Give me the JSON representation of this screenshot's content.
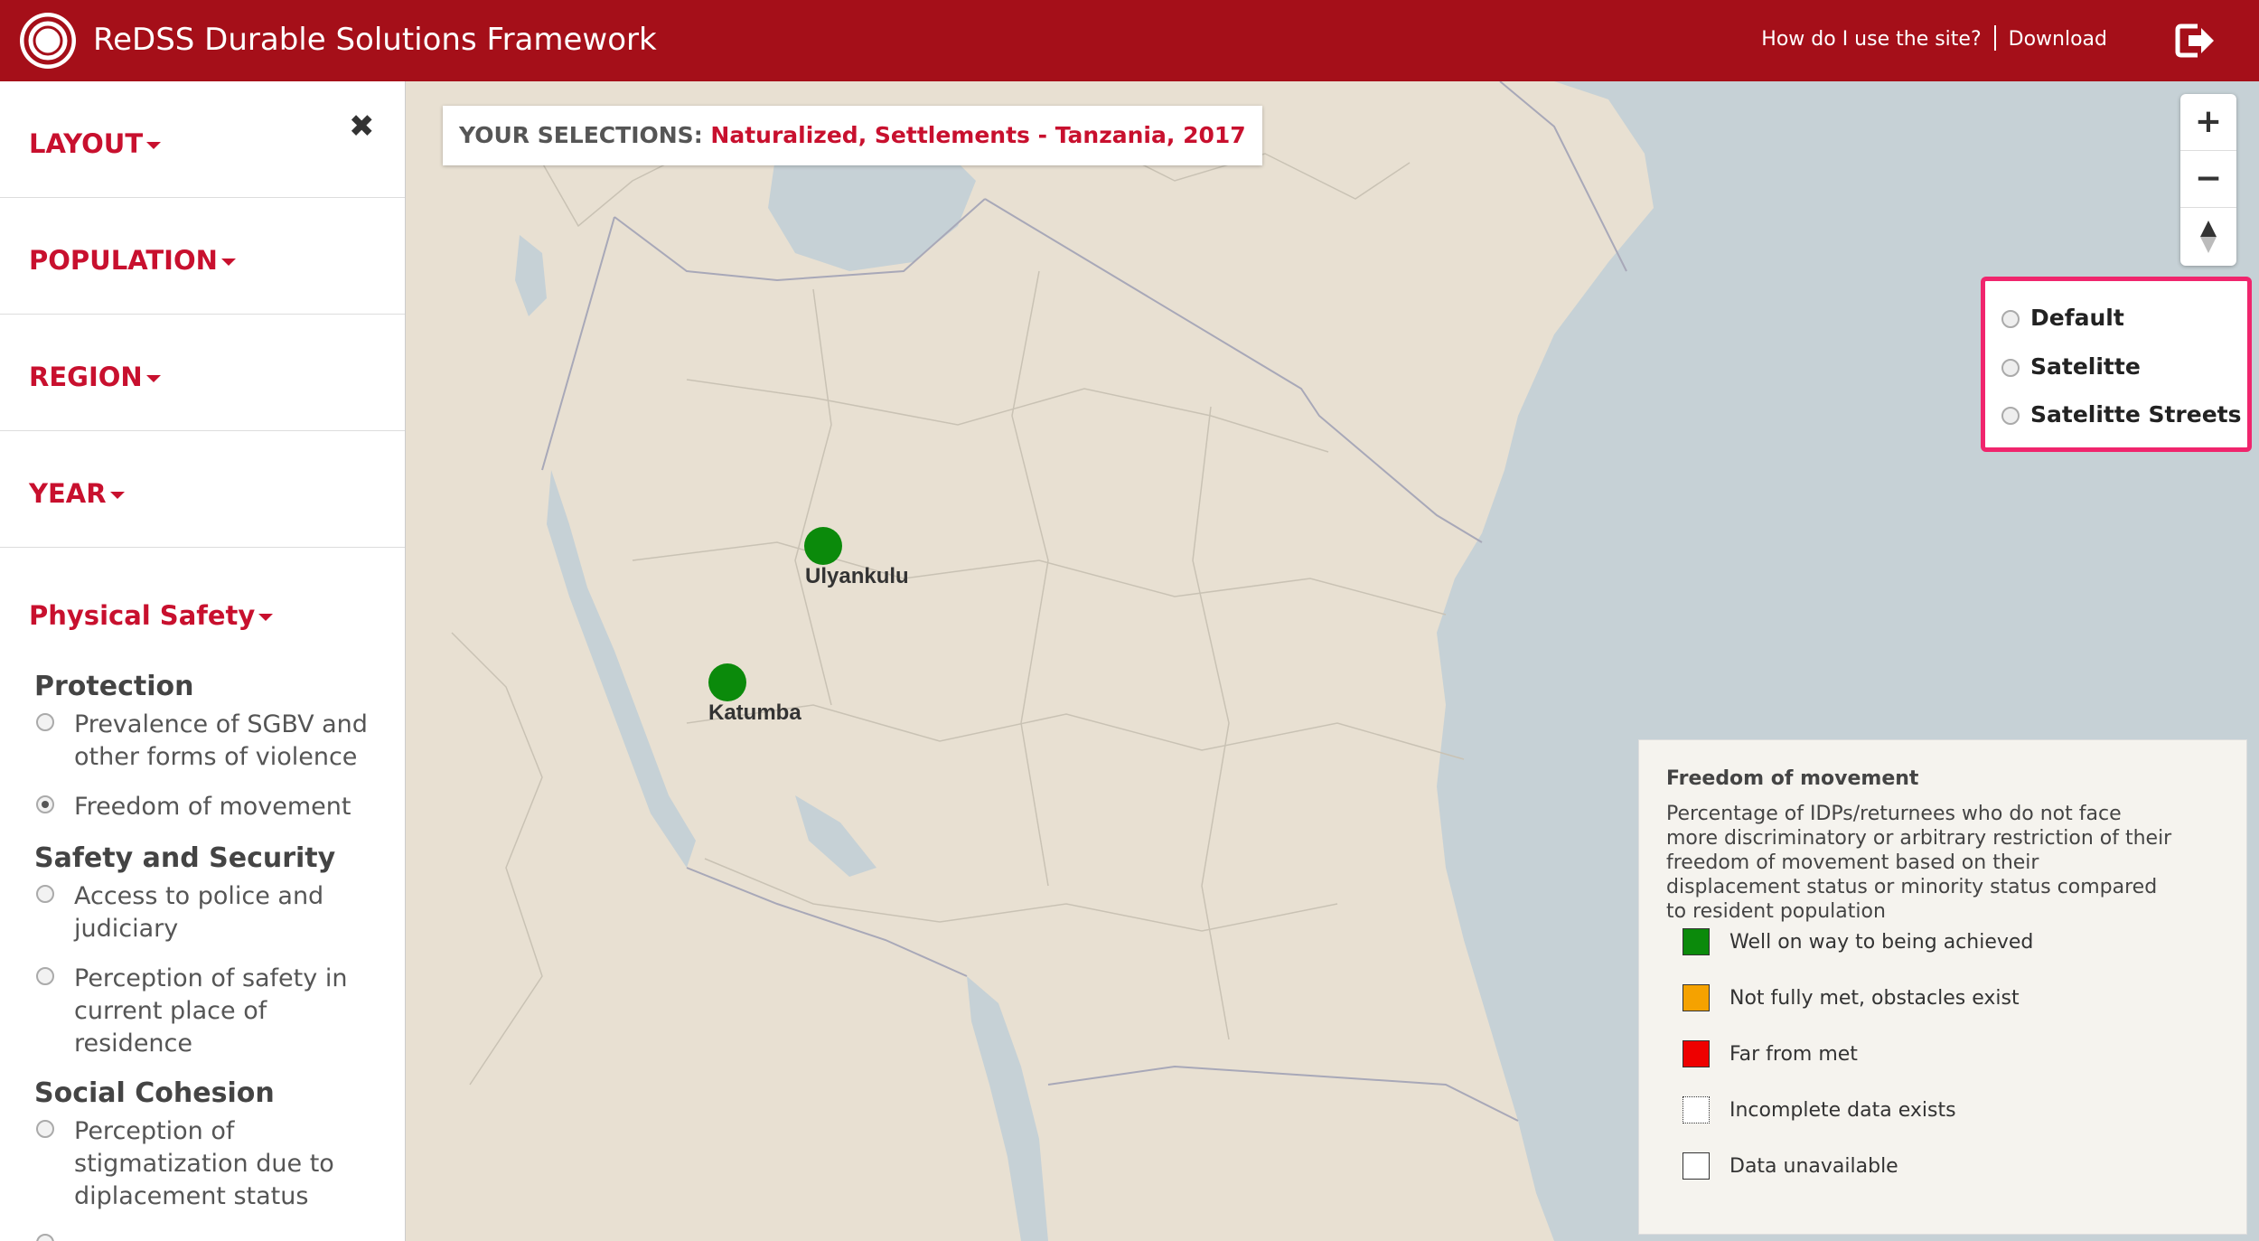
{
  "header": {
    "title": "ReDSS Durable Solutions Framework",
    "help_link": "How do I use the site?",
    "download_link": "Download"
  },
  "sidebar": {
    "sections": [
      {
        "label": "LAYOUT"
      },
      {
        "label": "POPULATION"
      },
      {
        "label": "REGION"
      },
      {
        "label": "YEAR"
      }
    ],
    "category": "Physical Safety",
    "groups": [
      {
        "title": "Protection",
        "options": [
          {
            "label": "Prevalence of SGBV and other forms of violence",
            "checked": false
          },
          {
            "label": "Freedom of movement",
            "checked": true
          }
        ]
      },
      {
        "title": "Safety and Security",
        "options": [
          {
            "label": "Access to police and judiciary",
            "checked": false
          },
          {
            "label": "Perception of safety in current place of residence",
            "checked": false
          }
        ]
      },
      {
        "title": "Social Cohesion",
        "options": [
          {
            "label": "Perception of stigmatization due to diplacement status",
            "checked": false
          }
        ]
      }
    ]
  },
  "selections": {
    "label": "YOUR SELECTIONS:",
    "value": "Naturalized, Settlements - Tanzania, 2017"
  },
  "basemap_options": [
    "Default",
    "Satelitte",
    "Satelitte Streets"
  ],
  "markers": [
    {
      "name": "Ulyankulu",
      "status": "Well on way to being achieved",
      "color": "#1a8a1a"
    },
    {
      "name": "Katumba",
      "status": "Well on way to being achieved",
      "color": "#1a8a1a"
    }
  ],
  "legend": {
    "title": "Freedom of movement",
    "description": "Percentage of IDPs/returnees who do not face more discriminatory or arbitrary restriction of their freedom of movement based on their displacement status or minority status compared to resident population",
    "items": [
      {
        "label": "Well on way to being achieved",
        "color": "#0b8a0b"
      },
      {
        "label": "Not fully met, obstacles exist",
        "color": "#f5a200"
      },
      {
        "label": "Far from met",
        "color": "#ee0000"
      },
      {
        "label": "Incomplete data exists",
        "color": "dotted"
      },
      {
        "label": "Data unavailable",
        "color": "#ffffff"
      }
    ]
  },
  "icons": {
    "logo": "redss-logo-icon",
    "exit": "logout-icon",
    "close": "close-icon",
    "zoom_in": "plus-icon",
    "zoom_out": "minus-icon",
    "compass": "compass-icon"
  }
}
